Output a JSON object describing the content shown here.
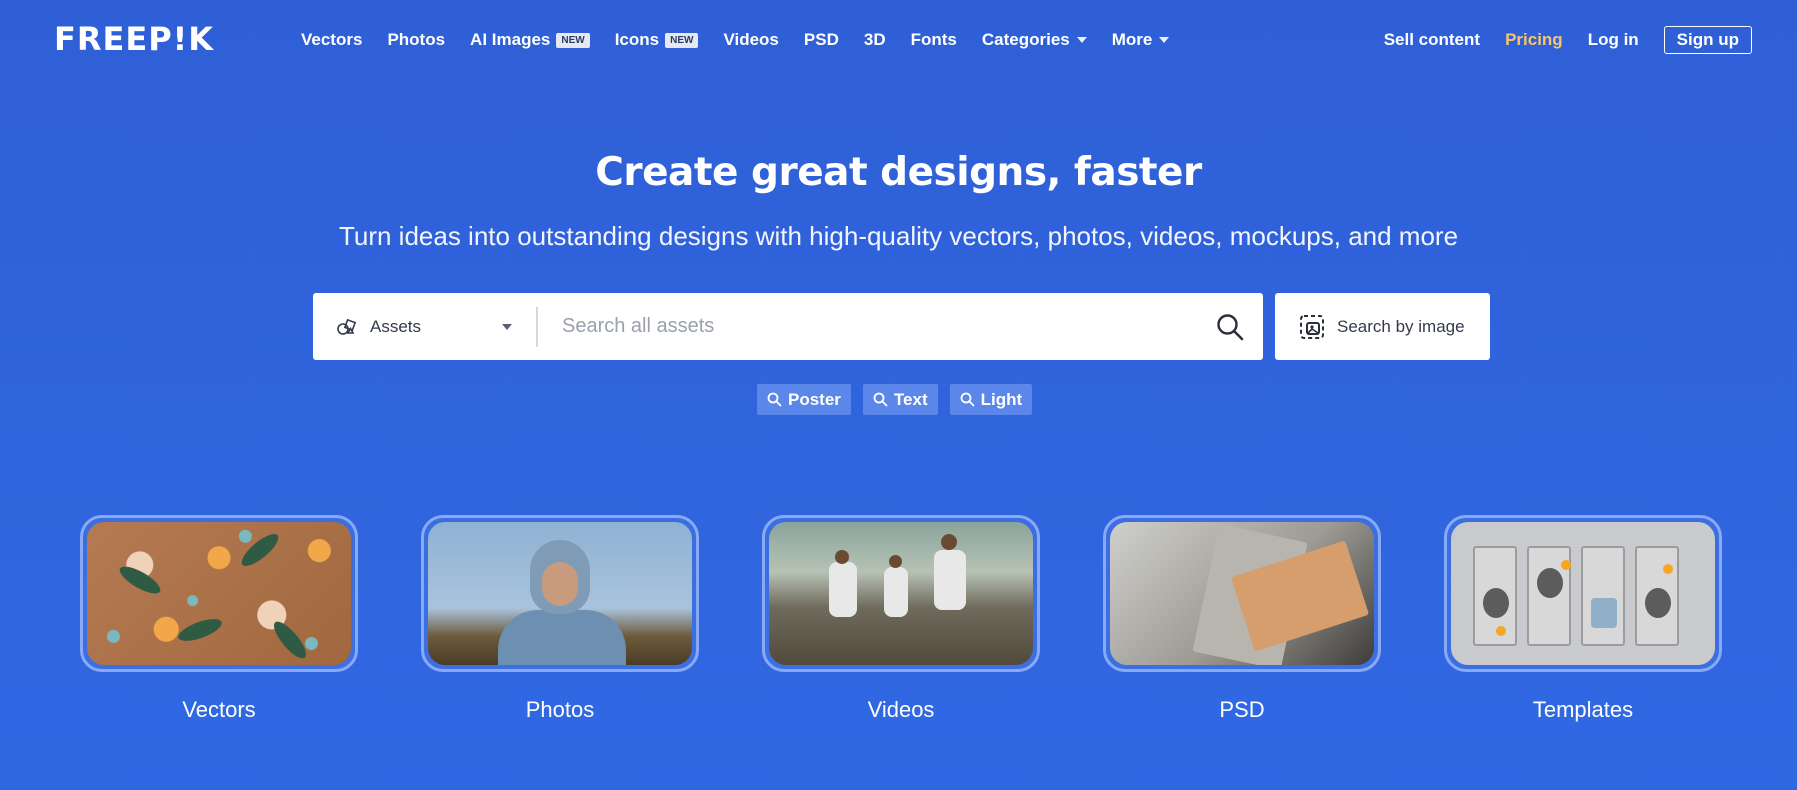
{
  "header": {
    "logo_text": "FREEP!K",
    "nav": [
      {
        "label": "Vectors"
      },
      {
        "label": "Photos"
      },
      {
        "label": "AI Images",
        "badge": "NEW"
      },
      {
        "label": "Icons",
        "badge": "NEW"
      },
      {
        "label": "Videos"
      },
      {
        "label": "PSD"
      },
      {
        "label": "3D"
      },
      {
        "label": "Fonts"
      },
      {
        "label": "Categories",
        "dropdown": true
      },
      {
        "label": "More",
        "dropdown": true
      }
    ],
    "right": {
      "sell": "Sell content",
      "pricing": "Pricing",
      "login": "Log in",
      "signup": "Sign up"
    }
  },
  "hero": {
    "title": "Create great designs, faster",
    "subtitle": "Turn ideas into outstanding designs with high-quality vectors, photos, videos, mockups, and more"
  },
  "search": {
    "type_selected": "Assets",
    "placeholder": "Search all assets",
    "value": "",
    "image_search_label": "Search by image",
    "icons": {
      "type": "shapes-icon",
      "submit": "search-icon",
      "image": "image-search-icon"
    }
  },
  "tags": [
    "Poster",
    "Text",
    "Light"
  ],
  "categories": [
    {
      "label": "Vectors"
    },
    {
      "label": "Photos"
    },
    {
      "label": "Videos"
    },
    {
      "label": "PSD"
    },
    {
      "label": "Templates"
    }
  ],
  "colors": {
    "background": "#3068e3",
    "accent_pricing": "#f7c46c",
    "tag_bg": "#5b86ea",
    "card_border": "#88a9f6"
  }
}
